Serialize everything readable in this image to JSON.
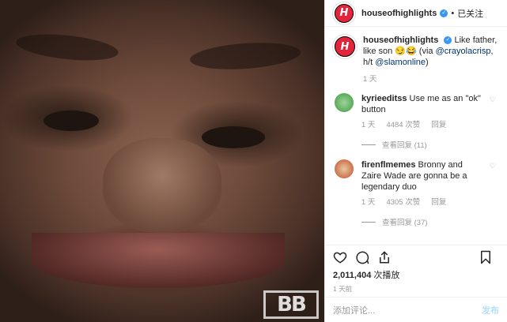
{
  "post": {
    "username": "houseofhighlights",
    "follow_state": "已关注",
    "caption_text": "Like father, like son 😏😂 (via ",
    "caption_mention1": "@crayolacrisp",
    "caption_mid": ", h/t ",
    "caption_mention2": "@slamonline",
    "caption_end": ")",
    "caption_time": "1 天"
  },
  "media": {
    "watermark": "BB"
  },
  "comments": [
    {
      "user": "kyrieeditss",
      "text": "Use me as an \"ok\" button",
      "time": "1 天",
      "likes": "4484 次赞",
      "reply": "回复",
      "view_replies": "查看回复 (11)"
    },
    {
      "user": "firenflmemes",
      "text": "Bronny and Zaire Wade are gonna be a legendary duo",
      "time": "1 天",
      "likes": "4305 次赞",
      "reply": "回复",
      "view_replies": "查看回复 (37)"
    }
  ],
  "stats": {
    "views_count": "2,011,404",
    "views_label": "次播放",
    "posted": "1 天前"
  },
  "add_comment": {
    "placeholder": "添加评论...",
    "post_label": "发布"
  },
  "colors": {
    "brand_red": "#e4243b",
    "verified_blue": "#3897f0",
    "link": "#003569"
  }
}
